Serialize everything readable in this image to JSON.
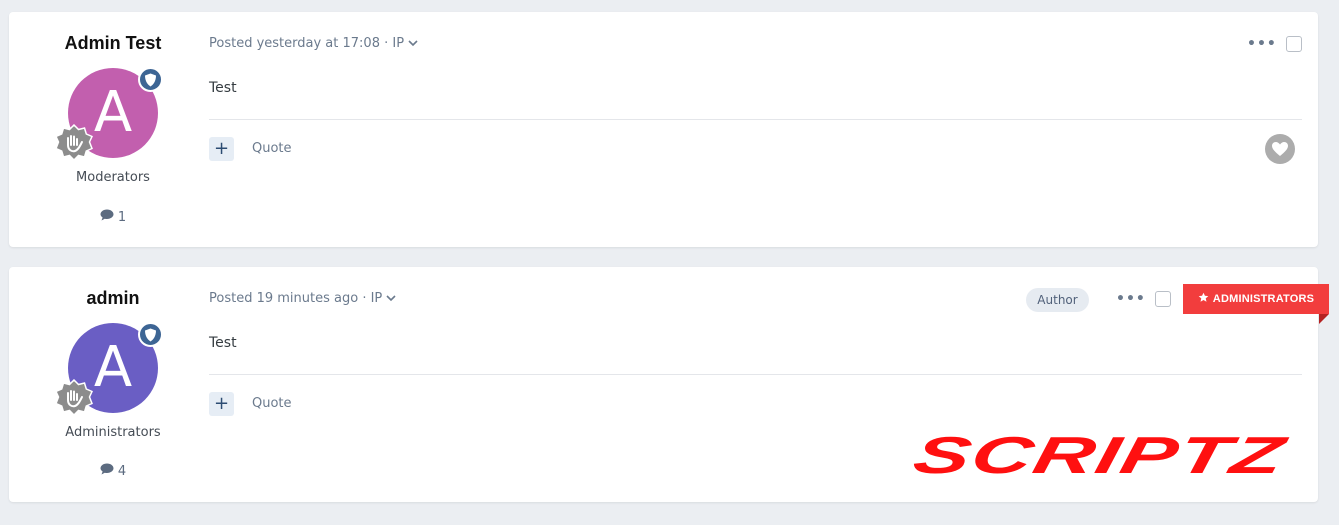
{
  "posts": [
    {
      "author_name": "Admin Test",
      "avatar_letter": "A",
      "avatar_color": "#c25fae",
      "group": "Moderators",
      "post_count": "1",
      "meta_text": "Posted yesterday at 17:08 · IP",
      "content": "Test",
      "plus_label": "+",
      "quote_label": "Quote"
    },
    {
      "author_name": "admin",
      "avatar_letter": "A",
      "avatar_color": "#6a5ec4",
      "group": "Administrators",
      "post_count": "4",
      "meta_text": "Posted 19 minutes ago · IP",
      "content": "Test",
      "plus_label": "+",
      "quote_label": "Quote",
      "author_badge": "Author",
      "ribbon_label": "ADMINISTRATORS"
    }
  ],
  "watermark_text": "SCRIPTZ",
  "colors": {
    "ribbon": "#f23d3d",
    "watermark": "#ff1010",
    "shield": "#3d6594"
  },
  "icons": [
    "shield-icon",
    "rank-hand-icon",
    "comment-icon",
    "chevron-down-icon",
    "heart-icon",
    "more-icon",
    "star-icon"
  ]
}
